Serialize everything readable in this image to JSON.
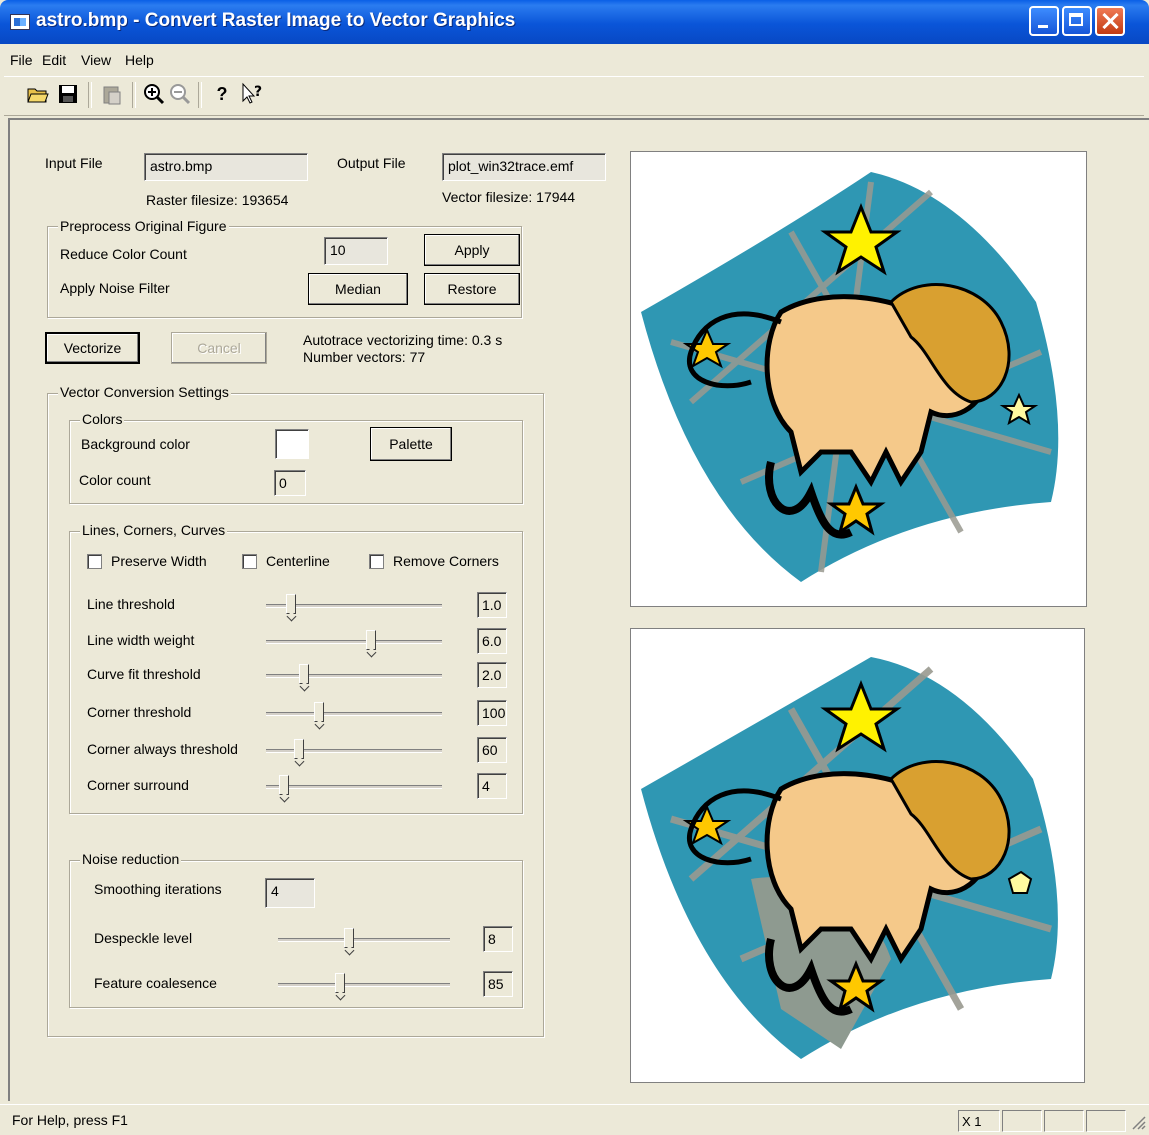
{
  "window": {
    "title": "astro.bmp - Convert Raster Image to Vector Graphics"
  },
  "menu": {
    "items": [
      {
        "label": "File"
      },
      {
        "label": "Edit"
      },
      {
        "label": "View"
      },
      {
        "label": "Help"
      }
    ]
  },
  "toolbar": {
    "icons": [
      "open-icon",
      "save-icon",
      "paste-icon",
      "zoom-in-icon",
      "zoom-out-icon",
      "help-icon",
      "context-help-icon"
    ]
  },
  "files": {
    "input_label": "Input File",
    "input_value": "astro.bmp",
    "output_label": "Output File",
    "output_value": "plot_win32trace.emf",
    "raster_size": "Raster filesize: 193654",
    "vector_size": "Vector filesize: 17944"
  },
  "preprocess": {
    "title": "Preprocess Original Figure",
    "reduce_label": "Reduce Color Count",
    "reduce_value": "10",
    "apply_label": "Apply",
    "noise_label": "Apply Noise Filter",
    "median_label": "Median",
    "restore_label": "Restore"
  },
  "actions": {
    "vectorize_label": "Vectorize",
    "cancel_label": "Cancel",
    "time_text": "Autotrace vectorizing time: 0.3 s",
    "vectors_text": "Number vectors:  77"
  },
  "settings": {
    "title": "Vector Conversion Settings",
    "colors": {
      "title": "Colors",
      "bg_label": "Background color",
      "bg_color": "#ffffff",
      "palette_label": "Palette",
      "count_label": "Color count",
      "count_value": "0"
    },
    "lines": {
      "title": "Lines, Corners, Curves",
      "checkboxes": [
        {
          "label": "Preserve Width",
          "checked": false
        },
        {
          "label": "Centerline",
          "checked": false
        },
        {
          "label": "Remove Corners",
          "checked": false
        }
      ],
      "sliders": [
        {
          "label": "Line threshold",
          "value": "1.0",
          "level": 0.12
        },
        {
          "label": "Line width weight",
          "value": "6.0",
          "level": 0.6
        },
        {
          "label": "Curve fit threshold",
          "value": "2.0",
          "level": 0.2
        },
        {
          "label": "Corner threshold",
          "value": "100",
          "level": 0.29
        },
        {
          "label": "Corner always threshold",
          "value": "60",
          "level": 0.17
        },
        {
          "label": "Corner surround",
          "value": "4",
          "level": 0.08
        }
      ]
    },
    "noise": {
      "title": "Noise reduction",
      "smoothing_label": "Smoothing iterations",
      "smoothing_value": "4",
      "sliders": [
        {
          "label": "Despeckle level",
          "value": "8",
          "level": 0.41
        },
        {
          "label": "Feature coalesence",
          "value": "85",
          "level": 0.35
        }
      ]
    }
  },
  "status": {
    "help_text": "For Help, press F1",
    "zoom_text": "X 1"
  },
  "colors": {
    "background": "#ece9d8",
    "title_blue": "#0a55d8",
    "lion_bg": "#2f97b3",
    "star": "#fff200"
  }
}
